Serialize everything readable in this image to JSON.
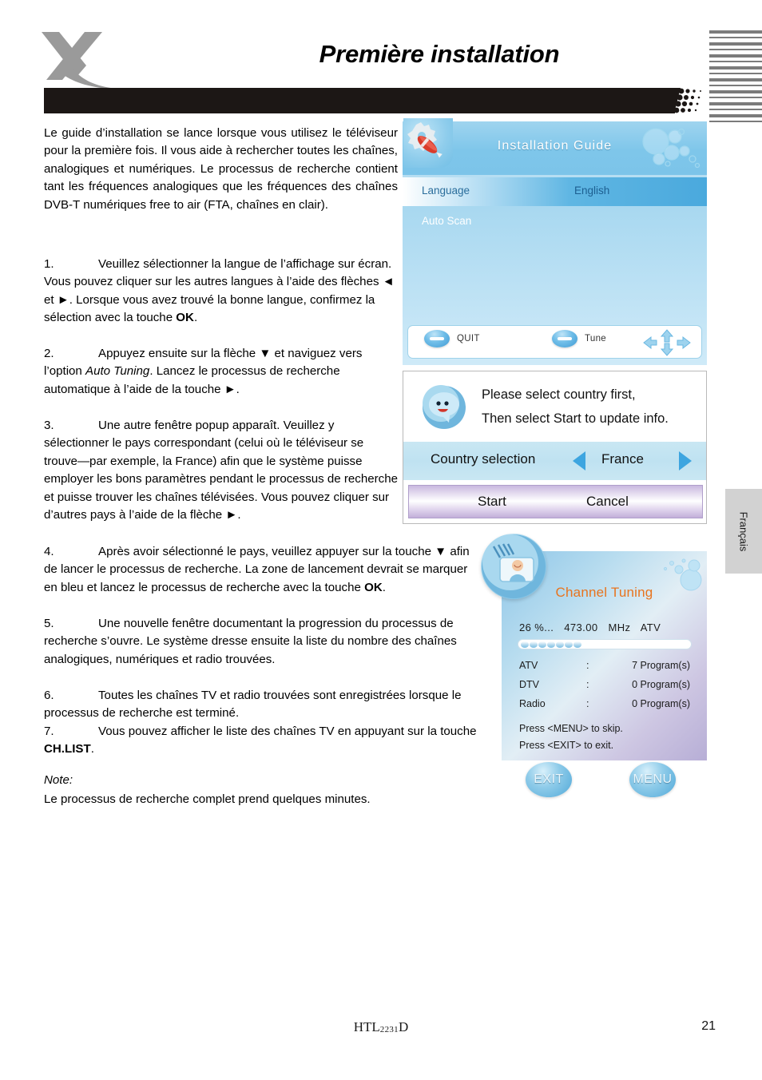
{
  "header": {
    "logo": "x-logo",
    "title": "Première installation"
  },
  "side_tab": {
    "label": "Français"
  },
  "body": {
    "intro": "Le guide d’installation se lance lorsque vous utilisez le téléviseur pour la première fois. Il vous aide à rechercher toutes les chaînes, analogiques et numériques. Le processus de recherche contient tant les fréquences analogiques que les fréquences des chaînes  DVB-T numériques free to air (FTA, chaînes en clair).",
    "steps": [
      {
        "num": "1.",
        "html": "Veuillez sélectionner la langue de l’affichage sur écran. Vous pouvez cliquer sur les autres langues à l’aide des flèches ◄ et ►. Lorsque vous avez trouvé la bonne langue, confirmez la sélection avec la touche <b>OK</b>."
      },
      {
        "num": "2.",
        "html": "Appuyez ensuite sur la flèche ▼ et naviguez vers l’option <i>Auto Tuning</i>. Lancez le processus de recherche automatique à l’aide de la touche ►."
      },
      {
        "num": "3.",
        "html": "Une autre fenêtre popup apparaît. Veuillez y sélectionner le pays correspondant (celui où le téléviseur se trouve—par exemple, la France) afin que le système puisse employer les bons paramètres pendant le processus de recherche et puisse trouver les chaînes télévisées. Vous pouvez cliquer sur d’autres pays à l’aide de la flèche ►."
      },
      {
        "num": "4.",
        "html": "Après avoir sélectionné le pays, veuillez appuyer sur la touche ▼ afin de lancer le processus de recherche. La zone de lancement devrait se marquer en bleu et lancez le processus de recherche avec la touche <b>OK</b>."
      },
      {
        "num": "5.",
        "html": "Une nouvelle fenêtre documentant la progression du processus de recherche s’ouvre. Le système dresse ensuite la liste du nombre des chaînes analogiques, numériques et radio trouvées."
      },
      {
        "num": "6.",
        "html": "Toutes les chaînes TV et radio trouvées sont enregistrées lorsque le processus de recherche est terminé."
      },
      {
        "num": "7.",
        "html": "Vous  pouvez afficher le liste des chaînes TV en appuyant sur la touche <b>CH.LIST</b>."
      }
    ],
    "note_label": "Note:",
    "note_text": "Le processus de recherche complet prend quelques minutes."
  },
  "screenshot_installation_guide": {
    "title": "Installation Guide",
    "rows": [
      {
        "label": "Language",
        "value": "English",
        "selected": true
      },
      {
        "label": "Auto Scan",
        "value": "",
        "selected": false
      }
    ],
    "buttons": [
      {
        "label": "QUIT"
      },
      {
        "label": "Tune"
      }
    ]
  },
  "screenshot_country_popup": {
    "message_line1": "Please select country first,",
    "message_line2": "Then select Start to update info.",
    "country_label": "Country selection",
    "country_value": "France",
    "actions": [
      {
        "label": "Start"
      },
      {
        "label": "Cancel"
      }
    ]
  },
  "screenshot_channel_tuning": {
    "title": "Channel Tuning",
    "progress_percent": "26 %...",
    "frequency": "473.00",
    "frequency_unit": "MHz",
    "mode": "ATV",
    "progress_value": 26,
    "stats": [
      {
        "key": "ATV",
        "colon": ":",
        "value": "7 Program(s)"
      },
      {
        "key": "DTV",
        "colon": ":",
        "value": "0 Program(s)"
      },
      {
        "key": "Radio",
        "colon": ":",
        "value": "0 Program(s)"
      }
    ],
    "hint1": "Press <MENU> to skip.",
    "hint2": "Press <EXIT> to exit.",
    "foot_buttons": [
      {
        "label": "EXIT"
      },
      {
        "label": "MENU"
      }
    ]
  },
  "footer": {
    "model_prefix": "HTL",
    "model_digits": "2231",
    "model_suffix": "D",
    "page_number": "21"
  },
  "colors": {
    "accent_orange": "#e8741e",
    "accent_blue": "#3da5e0",
    "bar_black": "#1c1715",
    "logo_gray": "#9a9a9a",
    "stripe_gray": "#7b7b7b"
  }
}
